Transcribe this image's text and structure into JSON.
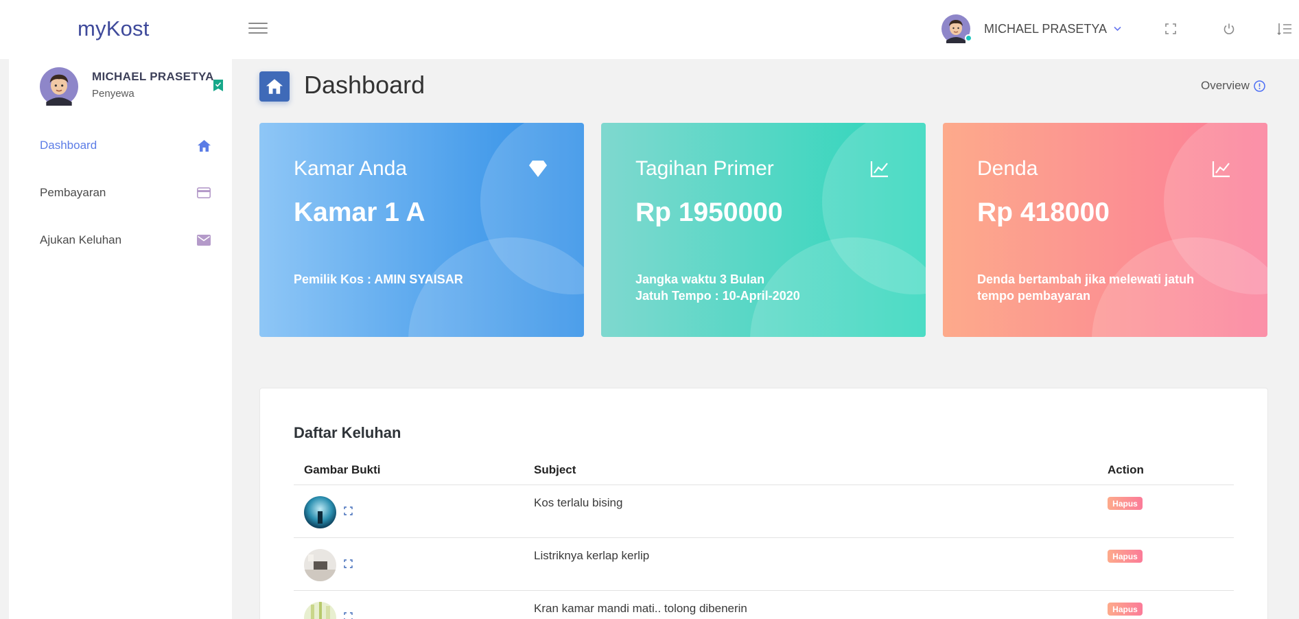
{
  "app": {
    "logo": "myKost"
  },
  "header": {
    "user_name": "MICHAEL PRASETYA"
  },
  "sidebar": {
    "user_name": "MICHAEL PRASETYA",
    "user_role": "Penyewa",
    "items": [
      {
        "label": "Dashboard",
        "icon": "home-icon",
        "active": true
      },
      {
        "label": "Pembayaran",
        "icon": "credit-card-icon",
        "active": false
      },
      {
        "label": "Ajukan Keluhan",
        "icon": "mail-icon",
        "active": false
      }
    ]
  },
  "page": {
    "title": "Dashboard",
    "overview_label": "Overview"
  },
  "cards": [
    {
      "label": "Kamar Anda",
      "value": "Kamar 1 A",
      "note_lines": [
        "Pemilik Kos : AMIN SYAISAR"
      ],
      "icon": "diamond-icon",
      "color": "#2b8ce6"
    },
    {
      "label": "Tagihan Primer",
      "value": "Rp 1950000",
      "note_lines": [
        "Jangka waktu 3 Bulan",
        "Jatuh Tempo : 10-April-2020"
      ],
      "icon": "chart-line-icon",
      "color": "#2ad6ba"
    },
    {
      "label": "Denda",
      "value": "Rp 418000",
      "note_lines": [
        "Denda bertambah jika melewati jatuh",
        "tempo pembayaran"
      ],
      "icon": "chart-line-icon",
      "color": "#fb7b98"
    }
  ],
  "complaints": {
    "title": "Daftar Keluhan",
    "columns": [
      "Gambar Bukti",
      "Subject",
      "Action"
    ],
    "rows": [
      {
        "subject": "Kos terlalu bising",
        "action": "Hapus"
      },
      {
        "subject": "Listriknya kerlap kerlip",
        "action": "Hapus"
      },
      {
        "subject": "Kran kamar mandi mati.. tolong dibenerin",
        "action": "Hapus"
      }
    ]
  }
}
